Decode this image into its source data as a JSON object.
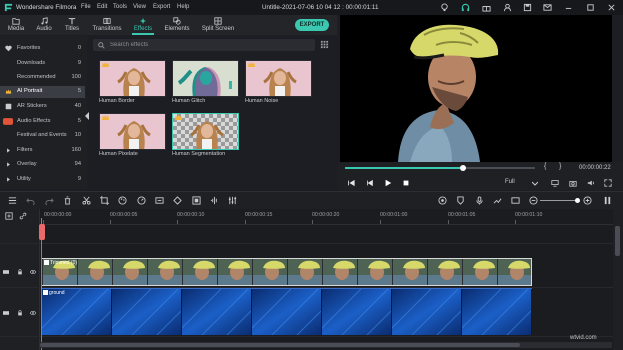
{
  "app": {
    "name": "Wondershare Filmora",
    "window_title": "Untitle-2021-07-06 10 04 12 : 00:00:01:11"
  },
  "menu": [
    "File",
    "Edit",
    "Tools",
    "View",
    "Export",
    "Help"
  ],
  "tabs": [
    {
      "label": "Media",
      "icon": "folder-icon"
    },
    {
      "label": "Audio",
      "icon": "music-note-icon"
    },
    {
      "label": "Titles",
      "icon": "text-icon"
    },
    {
      "label": "Transitions",
      "icon": "transition-icon"
    },
    {
      "label": "Effects",
      "icon": "sparkle-icon",
      "active": true
    },
    {
      "label": "Elements",
      "icon": "elements-icon"
    },
    {
      "label": "Split Screen",
      "icon": "split-screen-icon"
    }
  ],
  "export_label": "EXPORT",
  "sidebar": [
    {
      "label": "Favorites",
      "count": "0",
      "icon": "heart-icon"
    },
    {
      "label": "Downloads",
      "count": "9"
    },
    {
      "label": "Recommended",
      "count": "100"
    },
    {
      "label": "AI Portrait",
      "count": "5",
      "icon": "crown-icon",
      "active": true
    },
    {
      "label": "AR Stickers",
      "count": "40",
      "icon": "sticker-icon"
    },
    {
      "label": "Audio Effects",
      "count": "5",
      "icon": "new-badge-icon"
    },
    {
      "label": "Festival and Events",
      "count": "10"
    },
    {
      "label": "Filters",
      "count": "160",
      "icon": "caret-right-icon"
    },
    {
      "label": "Overlay",
      "count": "94",
      "icon": "caret-right-icon"
    },
    {
      "label": "Utility",
      "count": "9",
      "icon": "caret-right-icon"
    }
  ],
  "search": {
    "placeholder": "Search effects"
  },
  "effects": [
    {
      "label": "Human Border"
    },
    {
      "label": "Human Glitch"
    },
    {
      "label": "Human Noise"
    },
    {
      "label": "Human Pixelate"
    },
    {
      "label": "Human Segmentation",
      "selected": true
    }
  ],
  "preview": {
    "timecode": "00:00:00:22",
    "mark_in": "{",
    "mark_out": "}",
    "quality": "Full",
    "progress": 0.62
  },
  "timeline": {
    "ruler_labels": [
      "00:00:00:00",
      "00:00:00:05",
      "00:00:00:10",
      "00:00:00:15",
      "00:00:00:20",
      "00:00:01:00",
      "00:00:01:05",
      "00:00:01:10"
    ],
    "video_clip_title": "Trimmed (0)",
    "blue_clip_title": "ground"
  },
  "watermark": "wtvid.com",
  "colors": {
    "accent": "#3ac8b0",
    "helmet": "#d7d86a",
    "playhead": "#e05c5c"
  }
}
